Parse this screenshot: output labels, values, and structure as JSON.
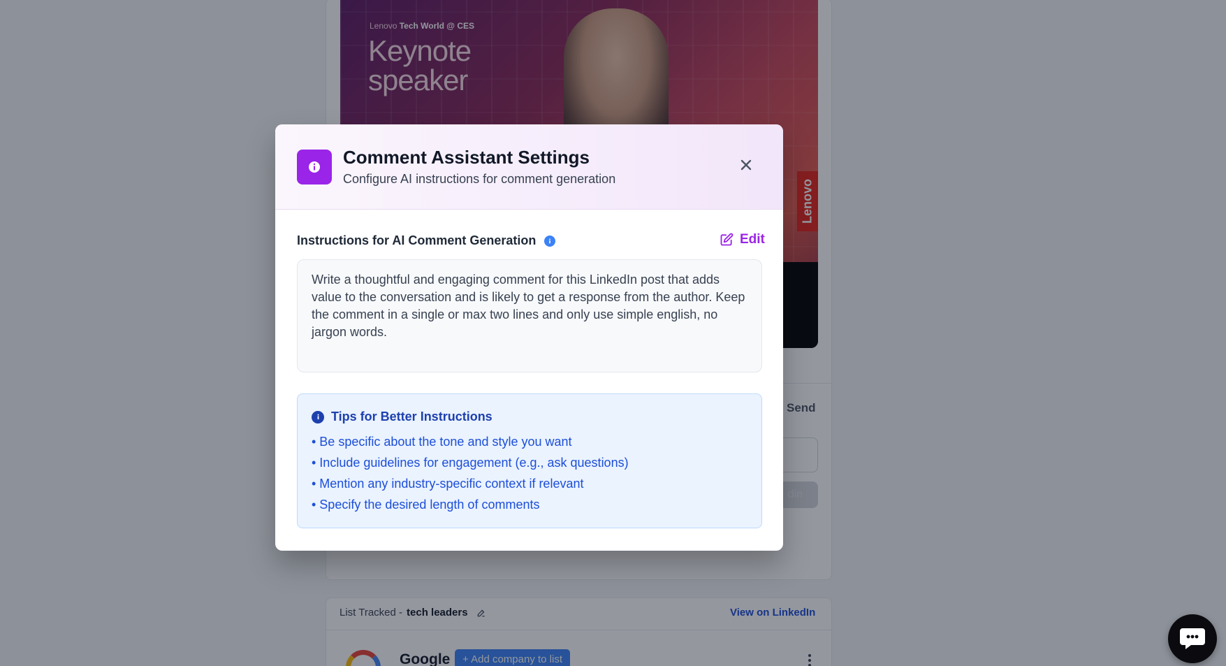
{
  "background": {
    "post_image": {
      "brand_line_prefix": "Lenovo",
      "brand_line_event": "Tech World @ CES",
      "headline_line1": "Keynote",
      "headline_line2": "speaker",
      "brand_tag": "Lenovo"
    },
    "send_label": "Send",
    "post_button_label": "din",
    "list_tracked": {
      "prefix": "List Tracked -",
      "list_name": "tech leaders",
      "view_link": "View on LinkedIn"
    },
    "company_row": {
      "name": "Google",
      "add_button": "+ Add company to list"
    }
  },
  "modal": {
    "title": "Comment Assistant Settings",
    "subtitle": "Configure AI instructions for comment generation",
    "section_label": "Instructions for AI Comment Generation",
    "edit_label": "Edit",
    "instructions_text": "Write a thoughtful and engaging comment for this LinkedIn post that adds value to the conversation and is likely to get a response from the author. Keep the comment in a single or max two lines and only use simple english, no jargon words.",
    "tips": {
      "title": "Tips for Better Instructions",
      "items": [
        "• Be specific about the tone and style you want",
        "• Include guidelines for engagement (e.g., ask questions)",
        "• Mention any industry-specific context if relevant",
        "• Specify the desired length of comments"
      ]
    }
  },
  "colors": {
    "accent_purple": "#9a24e8",
    "info_blue": "#3b82f6",
    "tips_text_blue": "#1d4ed8",
    "overlay": "rgba(17,24,39,0.45)"
  },
  "icons": {
    "header": "info-icon",
    "close": "close-icon",
    "edit": "edit-icon",
    "tips": "info-icon",
    "chat": "chat-bubble-icon"
  }
}
